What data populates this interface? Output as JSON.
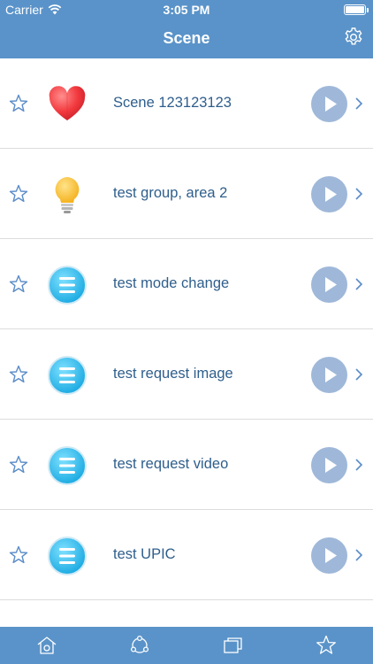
{
  "status_bar": {
    "carrier": "Carrier",
    "time": "3:05 PM",
    "battery_level": 1.0
  },
  "header": {
    "title": "Scene",
    "settings_icon": "gear-icon"
  },
  "scenes": [
    {
      "label": "Scene 123123123",
      "icon": "heart-icon"
    },
    {
      "label": "test group, area 2",
      "icon": "lightbulb-icon"
    },
    {
      "label": "test mode change",
      "icon": "list-icon"
    },
    {
      "label": "test request image",
      "icon": "list-icon"
    },
    {
      "label": "test request video",
      "icon": "list-icon"
    },
    {
      "label": "test UPIC",
      "icon": "list-icon"
    },
    {
      "label": "",
      "icon": "list-icon"
    }
  ],
  "tabbar": {
    "tabs": [
      {
        "name": "home-icon"
      },
      {
        "name": "share-nodes-icon"
      },
      {
        "name": "windows-icon"
      },
      {
        "name": "star-icon"
      }
    ]
  },
  "colors": {
    "header": "#5a93c9",
    "play_button": "#9fb8d9",
    "label": "#2e5e8c"
  }
}
